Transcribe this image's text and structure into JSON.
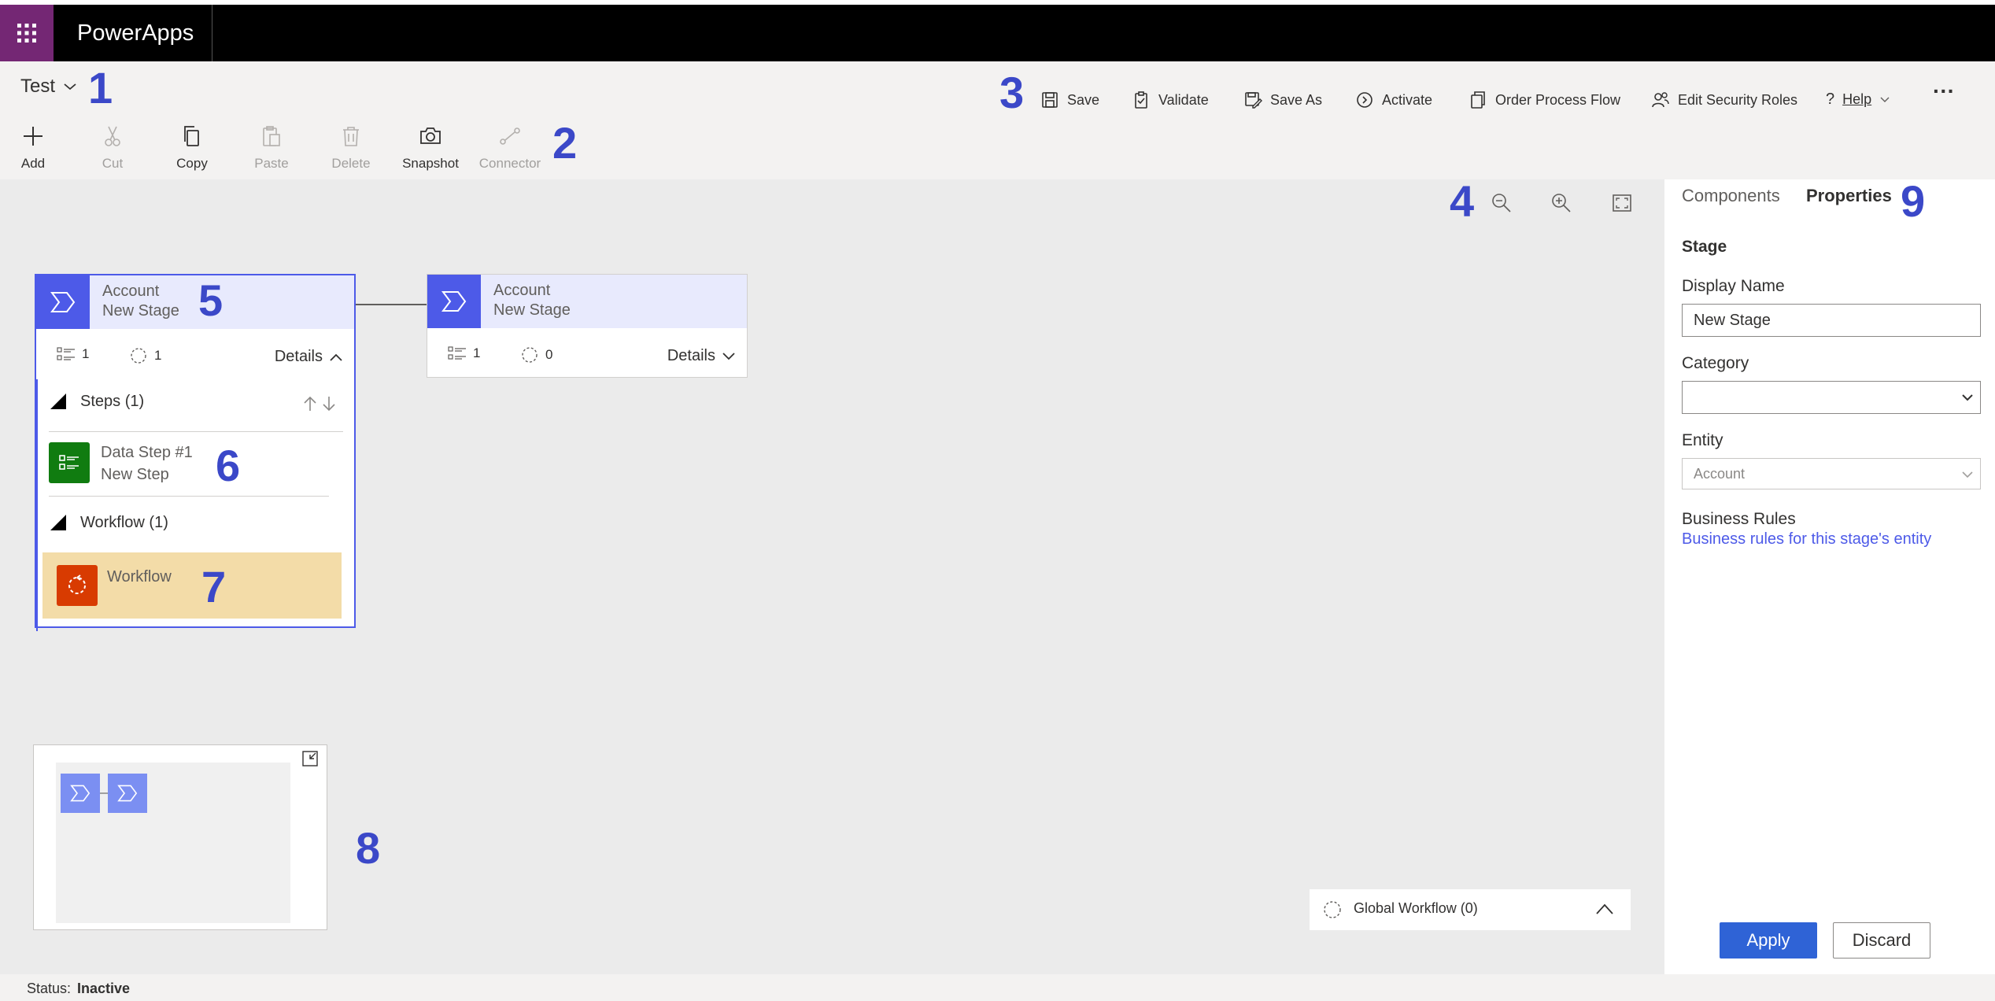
{
  "app": {
    "name": "PowerApps",
    "process_name": "Test"
  },
  "commands": {
    "save": "Save",
    "validate": "Validate",
    "save_as": "Save As",
    "activate": "Activate",
    "order_process_flow": "Order Process Flow",
    "edit_security_roles": "Edit Security Roles",
    "help": "Help",
    "more": "···"
  },
  "toolbar": {
    "add": "Add",
    "cut": "Cut",
    "copy": "Copy",
    "paste": "Paste",
    "delete": "Delete",
    "snapshot": "Snapshot",
    "connector": "Connector"
  },
  "annotations": [
    "1",
    "2",
    "3",
    "4",
    "5",
    "6",
    "7",
    "8",
    "9"
  ],
  "stages": [
    {
      "entity": "Account",
      "name": "New Stage",
      "steps_count": "1",
      "workflow_count": "1",
      "details_label": "Details",
      "expanded": true,
      "steps_header": "Steps (1)",
      "step": {
        "title": "Data Step #1",
        "subtitle": "New Step"
      },
      "workflow_header": "Workflow (1)",
      "workflow_item": "Workflow"
    },
    {
      "entity": "Account",
      "name": "New Stage",
      "steps_count": "1",
      "workflow_count": "0",
      "details_label": "Details",
      "expanded": false
    }
  ],
  "global_workflow": "Global Workflow (0)",
  "panel": {
    "tabs": [
      "Components",
      "Properties"
    ],
    "active_tab": "Properties",
    "section": "Stage",
    "display_name_label": "Display Name",
    "display_name_value": "New Stage",
    "category_label": "Category",
    "category_value": "",
    "entity_label": "Entity",
    "entity_value": "Account",
    "business_rules_label": "Business Rules",
    "business_rules_link": "Business rules for this stage's entity",
    "apply": "Apply",
    "discard": "Discard"
  },
  "status": {
    "label": "Status:",
    "value": "Inactive"
  },
  "colors": {
    "brand": "#742774",
    "stage_accent": "#4d5ae8",
    "step_green": "#107c10",
    "workflow_orange": "#d83b01",
    "workflow_highlight": "#f3dca8",
    "apply_blue": "#2f63d6",
    "annotation_blue": "#3b48c8"
  },
  "icons": {
    "waffle": "waffle-icon",
    "stage": "chevron-stage-icon",
    "step": "data-step-icon",
    "workflow": "workflow-icon"
  }
}
